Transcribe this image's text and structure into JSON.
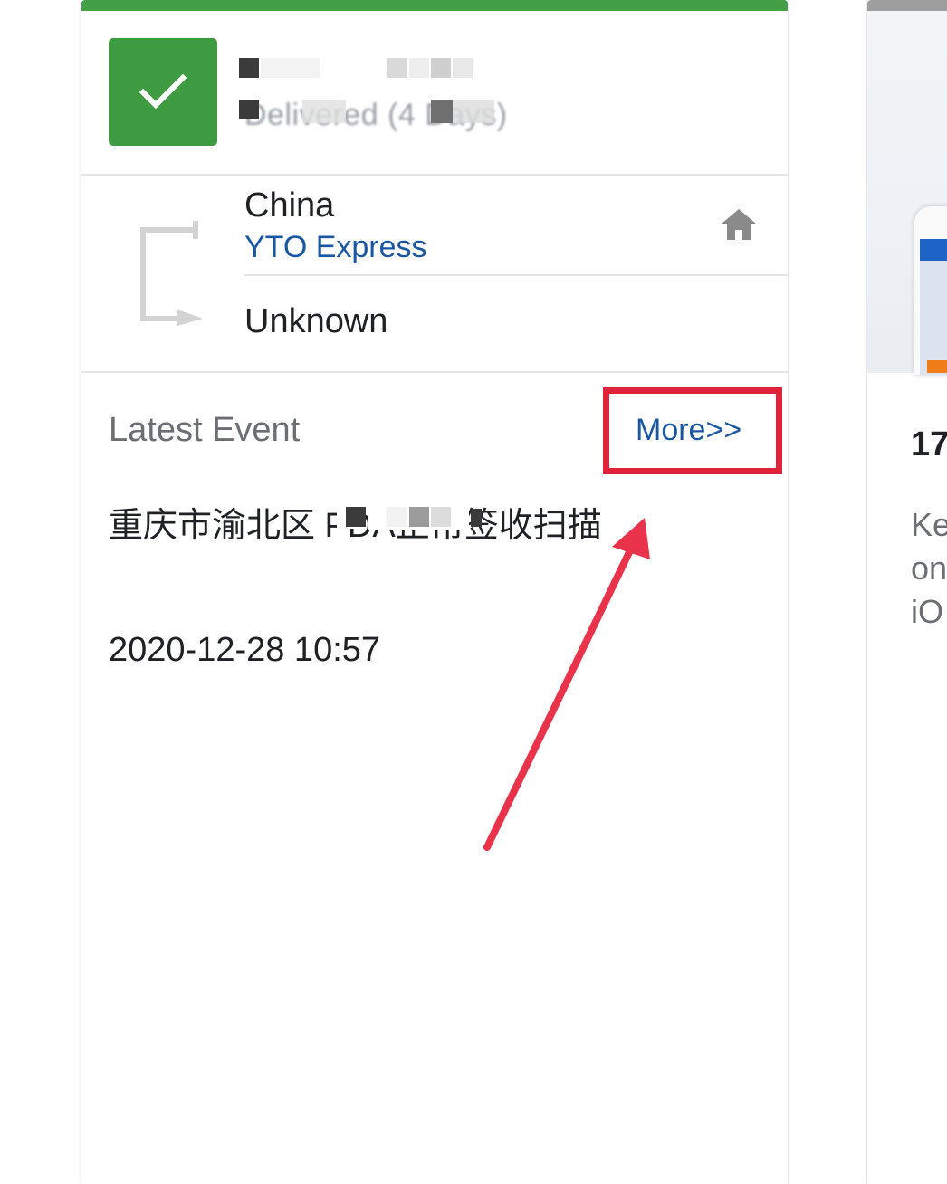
{
  "card": {
    "accent_color": "#43a047",
    "status_icon": "checkmark-icon",
    "status_text": "Delivered (4 Days)",
    "origin": {
      "country": "China",
      "carrier": "YTO Express"
    },
    "destination": {
      "country": "Unknown"
    },
    "route_icon": "route-bracket-icon",
    "home_icon": "home-icon",
    "latest_event": {
      "label": "Latest Event",
      "more_link": "More>>",
      "description": "重庆市渝北区 PDA正常签收扫描",
      "time": "2020-12-28 10:57"
    }
  },
  "annotation": {
    "highlight_color": "#e0223a",
    "arrow_color": "#e8334a"
  },
  "side_card": {
    "number": "17",
    "description": "Ke\non\niO"
  }
}
